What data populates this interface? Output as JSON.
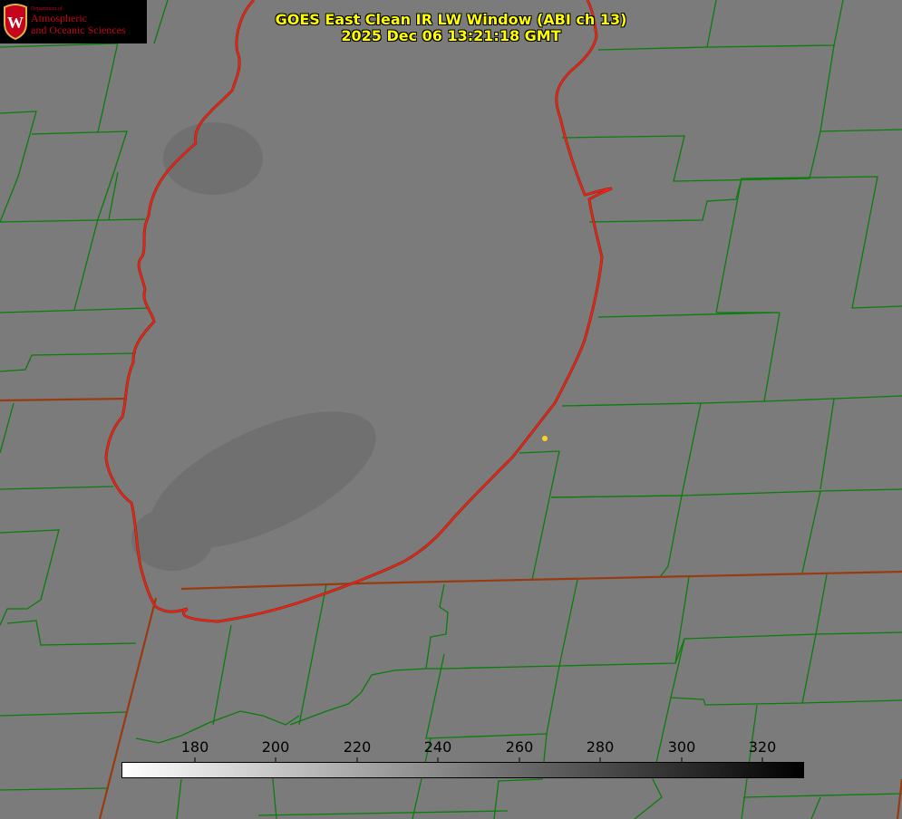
{
  "logo": {
    "department": "Department of",
    "line1": "Atmospheric",
    "line2": "and Oceanic Sciences"
  },
  "title": {
    "line1": "GOES East Clean IR LW Window (ABI ch 13)",
    "line2": "2025 Dec 06 13:21:18 GMT"
  },
  "colorbar": {
    "tick_labels": [
      "180",
      "200",
      "220",
      "240",
      "260",
      "280",
      "300",
      "320"
    ],
    "range": [
      162,
      332
    ],
    "colors": {
      "low": "#ffffff",
      "high": "#000000"
    }
  },
  "map": {
    "colors": {
      "background": "#7b7b7b",
      "cloud": "#6a6a6a",
      "county_lines": "#0a7d0a",
      "state_lines": "#8b4513",
      "lake_outline": "#ff1a1a",
      "marker": "#ffd21f"
    }
  }
}
